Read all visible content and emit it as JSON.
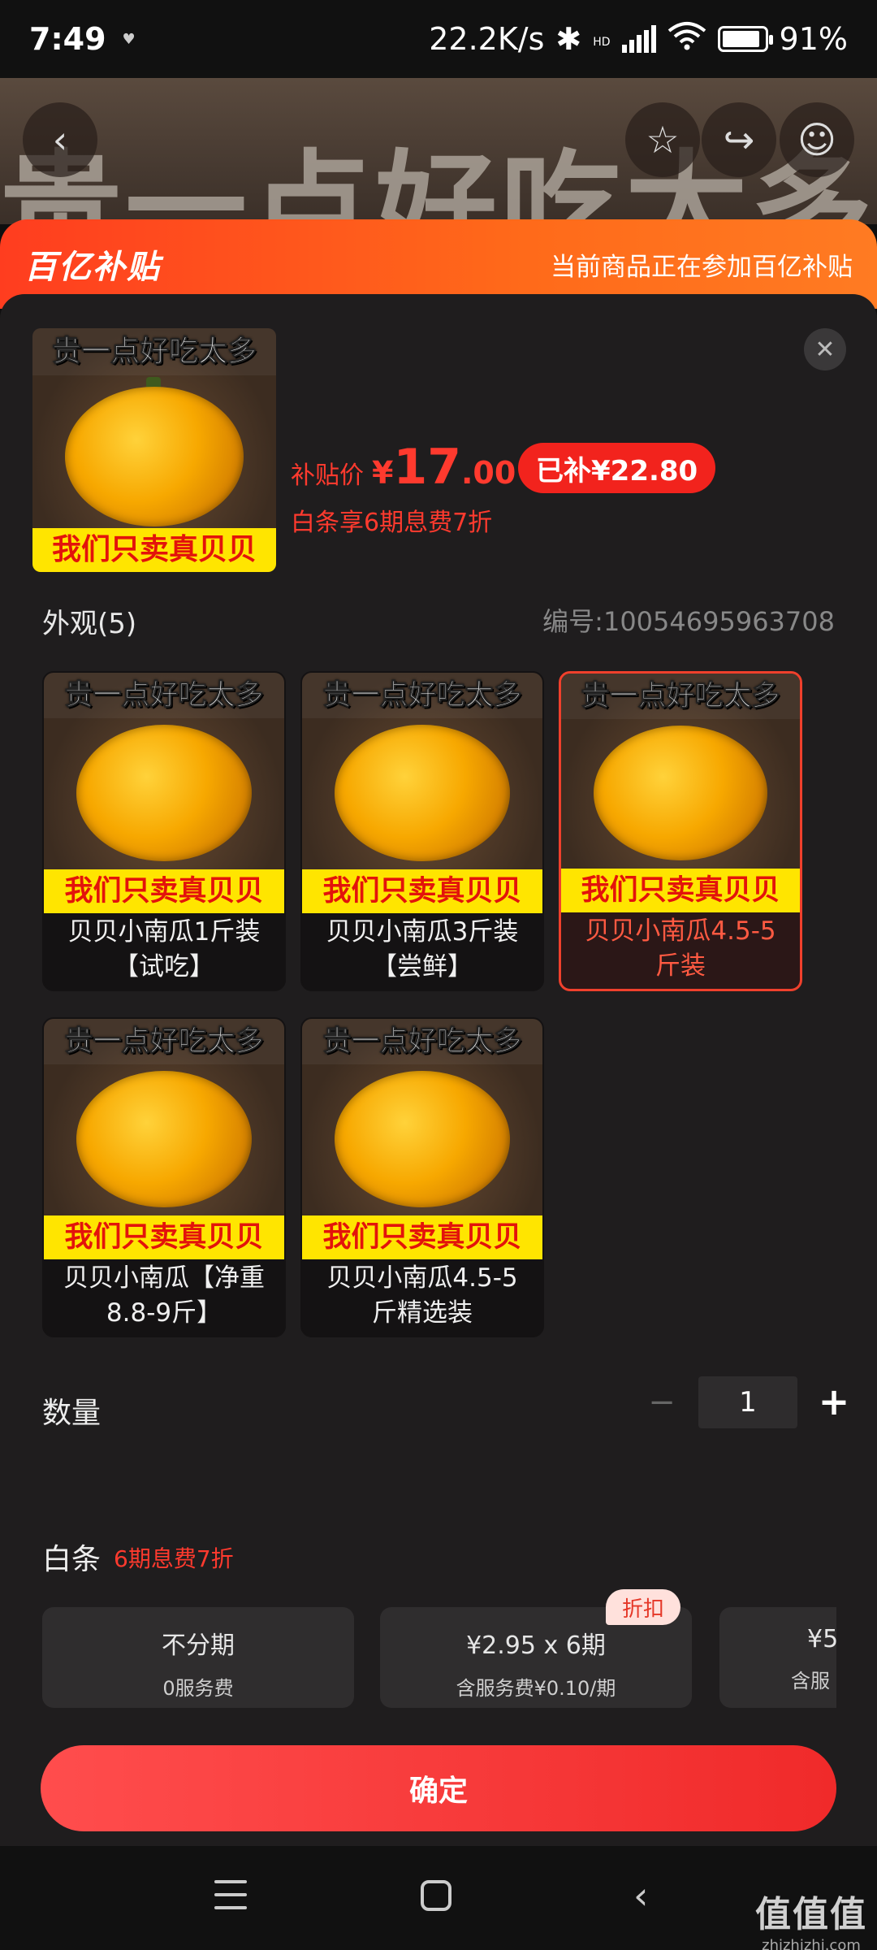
{
  "status_bar": {
    "time": "7:49",
    "net_speed": "22.2K/s",
    "hd": "HD",
    "battery": "91%"
  },
  "background": {
    "hero_text": "贵一点好吃太多"
  },
  "banner": {
    "logo": "百亿补贴",
    "info": "当前商品正在参加百亿补贴"
  },
  "product": {
    "image_top_text": "贵一点好吃太多",
    "image_bottom_text": "我们只卖真贝贝",
    "price_label": "补贴价",
    "currency": "¥",
    "price_int": "17",
    "price_dec": ".00",
    "subsidy_badge": "已补¥22.80",
    "installment_note": "白条享6期息费7折"
  },
  "appearance": {
    "title": "外观(5)",
    "sku_no": "编号:100546959637​08",
    "options": [
      {
        "label": "贝贝小南瓜1斤装【试吃】",
        "selected": false
      },
      {
        "label": "贝贝小南瓜3斤装【尝鲜】",
        "selected": false
      },
      {
        "label": "贝贝小南瓜4.5-5斤装",
        "selected": true
      },
      {
        "label": "贝贝小南瓜【净重8.8-9斤】",
        "selected": false
      },
      {
        "label": "贝贝小南瓜4.5-5斤精选装",
        "selected": false
      }
    ]
  },
  "quantity": {
    "label": "数量",
    "minus": "−",
    "value": "1",
    "plus": "+"
  },
  "baitiao": {
    "label": "白条",
    "promo": "6期息费7折",
    "discount_tag": "折扣",
    "plans": [
      {
        "title": "不分期",
        "fee": "0服务费"
      },
      {
        "title": "¥2.95 x 6期",
        "fee": "含服务费¥0.10/期"
      },
      {
        "title": "¥5",
        "fee": "含服"
      }
    ]
  },
  "confirm": "确定",
  "watermark": {
    "logo": "值值值",
    "site": "zhizhizhi.com"
  },
  "colors": {
    "accent": "#f2231d",
    "banner": "#ff5a1f",
    "sheet": "#1f1d1e"
  }
}
